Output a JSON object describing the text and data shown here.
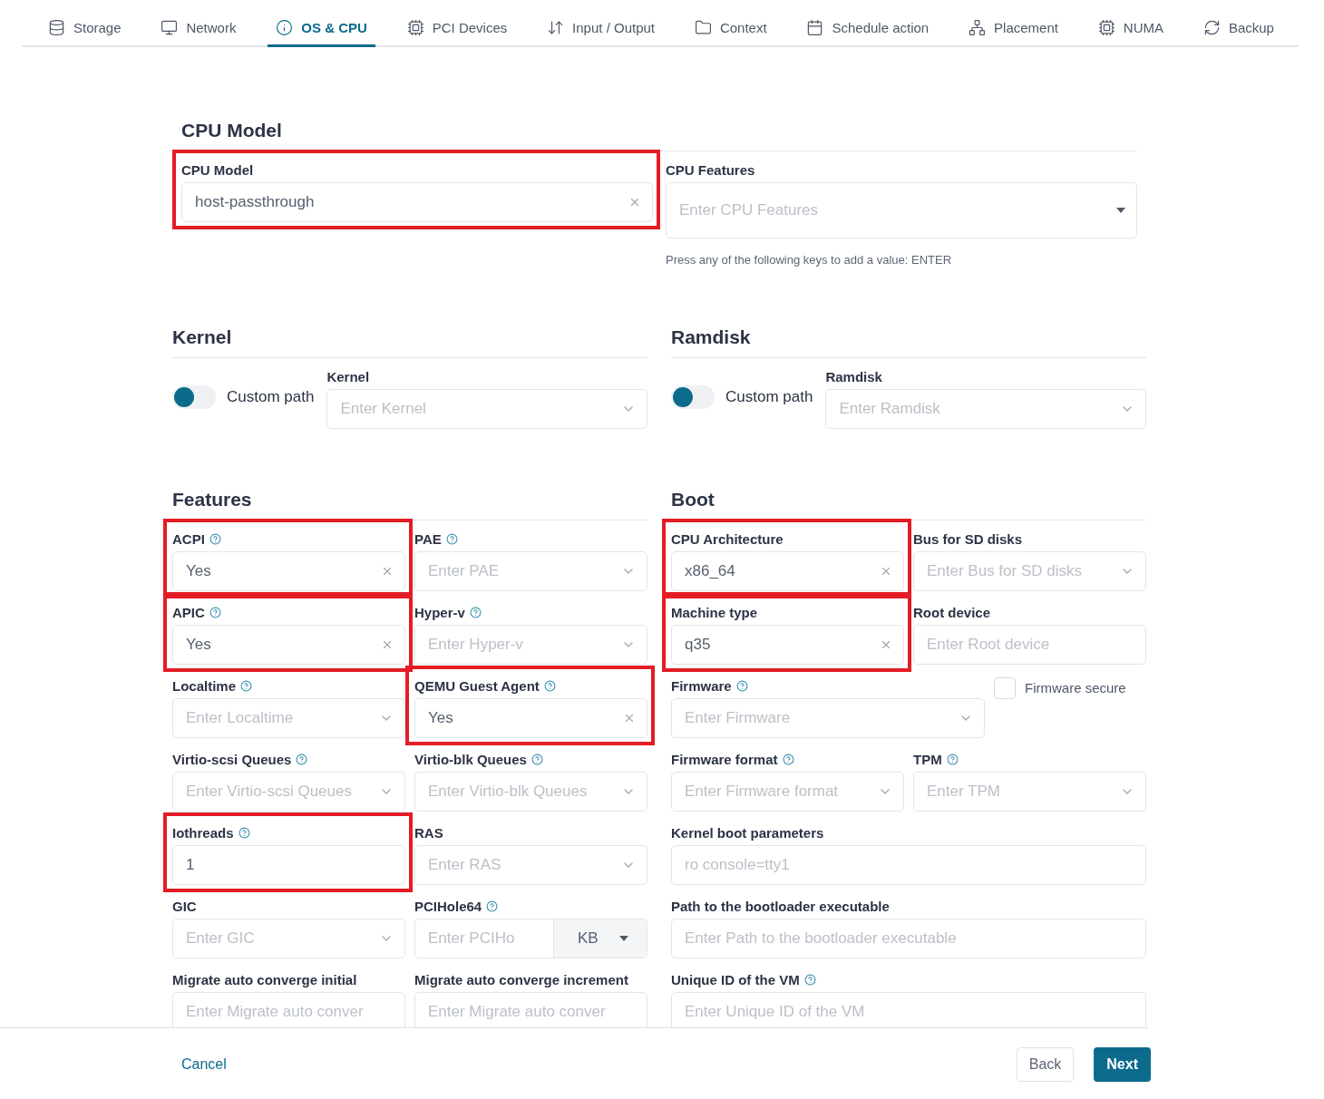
{
  "tabs": [
    {
      "label": "Storage",
      "selected": false
    },
    {
      "label": "Network",
      "selected": false
    },
    {
      "label": "OS & CPU",
      "selected": true
    },
    {
      "label": "PCI Devices",
      "selected": false
    },
    {
      "label": "Input / Output",
      "selected": false
    },
    {
      "label": "Context",
      "selected": false
    },
    {
      "label": "Schedule action",
      "selected": false
    },
    {
      "label": "Placement",
      "selected": false
    },
    {
      "label": "NUMA",
      "selected": false
    },
    {
      "label": "Backup",
      "selected": false
    }
  ],
  "cpu_model": {
    "title": "CPU Model",
    "fields": [
      {
        "kind": "input",
        "label": "CPU Model",
        "value": "host-passthrough",
        "clearable": true,
        "highlighted": true
      },
      {
        "kind": "dropdown",
        "label": "CPU Features",
        "placeholder": "Enter CPU Features",
        "hint": "Press any of the following keys to add a value: ENTER",
        "highlighted": false
      }
    ]
  },
  "path_sections": [
    {
      "title": "Kernel",
      "toggle": {
        "label": "Custom path",
        "on": false
      },
      "field": {
        "label": "Kernel",
        "placeholder": "Enter Kernel"
      }
    },
    {
      "title": "Ramdisk",
      "toggle": {
        "label": "Custom path",
        "on": false
      },
      "field": {
        "label": "Ramdisk",
        "placeholder": "Enter Ramdisk"
      }
    }
  ],
  "grids": [
    {
      "title": "Features",
      "fields": [
        {
          "kind": "select",
          "label": "ACPI",
          "help": true,
          "value": "Yes",
          "highlighted": true
        },
        {
          "kind": "select",
          "label": "PAE",
          "help": true,
          "placeholder": "Enter PAE",
          "highlighted": false
        },
        {
          "kind": "select",
          "label": "APIC",
          "help": true,
          "value": "Yes",
          "highlighted": true
        },
        {
          "kind": "select",
          "label": "Hyper-v",
          "help": true,
          "placeholder": "Enter Hyper-v",
          "highlighted": false
        },
        {
          "kind": "select",
          "label": "Localtime",
          "help": true,
          "placeholder": "Enter Localtime",
          "highlighted": false
        },
        {
          "kind": "select",
          "label": "QEMU Guest Agent",
          "help": true,
          "value": "Yes",
          "highlighted": true
        },
        {
          "kind": "select",
          "label": "Virtio-scsi Queues",
          "help": true,
          "placeholder": "Enter Virtio-scsi Queues",
          "highlighted": false
        },
        {
          "kind": "select",
          "label": "Virtio-blk Queues",
          "help": true,
          "placeholder": "Enter Virtio-blk Queues",
          "highlighted": false
        },
        {
          "kind": "input",
          "label": "Iothreads",
          "help": true,
          "value": "1",
          "highlighted": true
        },
        {
          "kind": "select",
          "label": "RAS",
          "help": false,
          "placeholder": "Enter RAS",
          "highlighted": false
        },
        {
          "kind": "select",
          "label": "GIC",
          "help": false,
          "placeholder": "Enter GIC",
          "highlighted": false
        },
        {
          "kind": "unit",
          "label": "PCIHole64",
          "help": true,
          "placeholder": "Enter PCIHo",
          "unit": "KB",
          "highlighted": false
        },
        {
          "kind": "input",
          "label": "Migrate auto converge initial",
          "help": false,
          "placeholder": "Enter Migrate auto conver",
          "highlighted": false
        },
        {
          "kind": "input",
          "label": "Migrate auto converge increment",
          "help": false,
          "placeholder": "Enter Migrate auto conver",
          "highlighted": false
        }
      ]
    },
    {
      "title": "Boot",
      "fields": [
        {
          "kind": "select",
          "label": "CPU Architecture",
          "help": false,
          "value": "x86_64",
          "highlighted": true
        },
        {
          "kind": "select",
          "label": "Bus for SD disks",
          "help": false,
          "placeholder": "Enter Bus for SD disks",
          "highlighted": false
        },
        {
          "kind": "select",
          "label": "Machine type",
          "help": false,
          "value": "q35",
          "highlighted": true
        },
        {
          "kind": "input",
          "label": "Root device",
          "help": false,
          "placeholder": "Enter Root device",
          "highlighted": false
        },
        {
          "kind": "select",
          "label": "Firmware",
          "help": true,
          "placeholder": "Enter Firmware",
          "highlighted": false,
          "side_checkbox": {
            "label": "Firmware secure",
            "checked": false
          }
        },
        {
          "kind": "select",
          "label": "Firmware format",
          "help": true,
          "placeholder": "Enter Firmware format",
          "highlighted": false
        },
        {
          "kind": "select",
          "label": "TPM",
          "help": true,
          "placeholder": "Enter TPM",
          "highlighted": false
        },
        {
          "kind": "input",
          "label": "Kernel boot parameters",
          "help": false,
          "placeholder": "ro console=tty1",
          "wide": true,
          "highlighted": false
        },
        {
          "kind": "input",
          "label": "Path to the bootloader executable",
          "help": false,
          "placeholder": "Enter Path to the bootloader executable",
          "wide": true,
          "highlighted": false
        },
        {
          "kind": "input",
          "label": "Unique ID of the VM",
          "help": true,
          "placeholder": "Enter Unique ID of the VM",
          "wide": true,
          "highlighted": false
        }
      ]
    }
  ],
  "footer": {
    "cancel": "Cancel",
    "back": "Back",
    "next": "Next"
  }
}
